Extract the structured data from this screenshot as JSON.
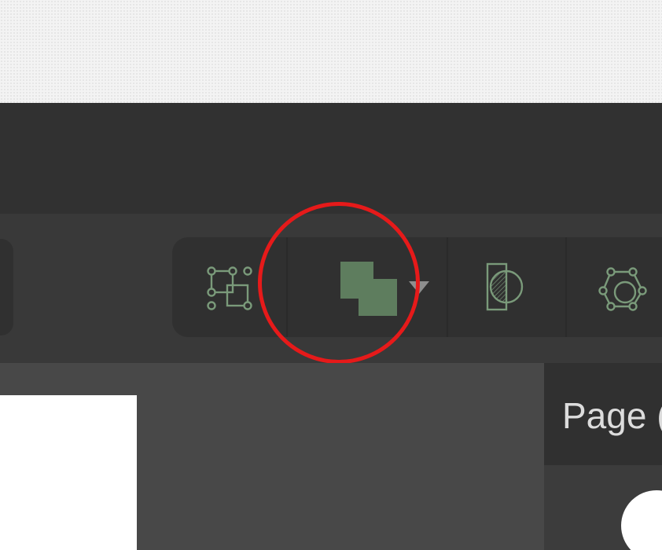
{
  "toolbar": {
    "tools": [
      {
        "name": "frame-icon"
      },
      {
        "name": "union-shapes-icon",
        "selected": true
      },
      {
        "name": "mask-icon"
      },
      {
        "name": "path-nodes-icon"
      }
    ],
    "dropdown": {
      "name": "chevron-down-icon"
    }
  },
  "panel": {
    "title": "Page ("
  },
  "colors": {
    "accent_green": "#5e7d5e",
    "icon_green": "#7a9a7a",
    "highlight_ring": "#e61a1a",
    "toolbar_bg": "#393939",
    "title_bar_bg": "#313131"
  }
}
